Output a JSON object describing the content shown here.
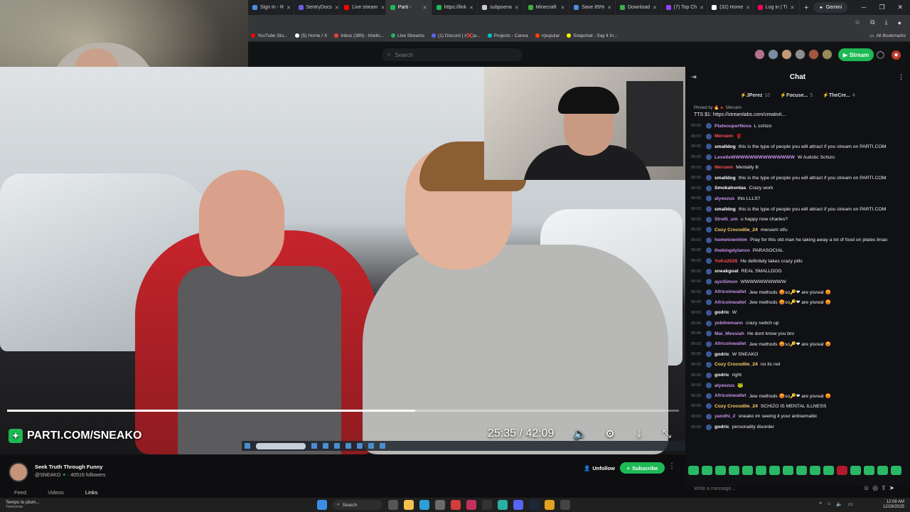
{
  "browser": {
    "tabs": [
      {
        "label": "Sign In - R",
        "color": "#4a90e2",
        "active": false
      },
      {
        "label": "SentryDocs",
        "color": "#6c5ce7",
        "active": false
      },
      {
        "label": "Live stream",
        "color": "#ff0000",
        "active": false
      },
      {
        "label": "Parti - ",
        "color": "#1db954",
        "active": true
      },
      {
        "label": "https://link",
        "color": "#1db954",
        "active": false
      },
      {
        "label": "subpoena",
        "color": "#cccccc",
        "active": false
      },
      {
        "label": "Minecraft",
        "color": "#3cb043",
        "active": false
      },
      {
        "label": "Save 85%",
        "color": "#4a90e2",
        "active": false
      },
      {
        "label": "Download",
        "color": "#3cb043",
        "active": false
      },
      {
        "label": "(7) Top Ch",
        "color": "#9146ff",
        "active": false
      },
      {
        "label": "(32) Home",
        "color": "#ffffff",
        "active": false
      },
      {
        "label": "Log in | Ti",
        "color": "#ff0050",
        "active": false
      }
    ],
    "new_tab": "+",
    "gemini_label": "Gemini",
    "bookmarks": [
      {
        "label": "YouTube Stu...",
        "color": "#ff0000"
      },
      {
        "label": "(5) Home / X",
        "color": "#ffffff"
      },
      {
        "label": "Inbox (389) - khells...",
        "color": "#ea4335"
      },
      {
        "label": "Live Streams",
        "color": "#1db954"
      },
      {
        "label": "(1) Discord | #❌|a...",
        "color": "#5865f2"
      },
      {
        "label": "Projects - Canva",
        "color": "#00c4cc"
      },
      {
        "label": "r/popular",
        "color": "#ff4500"
      },
      {
        "label": "Snapchat - Say it In...",
        "color": "#fffc00"
      }
    ],
    "all_bookmarks": "All Bookmarks"
  },
  "site": {
    "search_placeholder": "Search",
    "stream_button": "Stream"
  },
  "player": {
    "watermark": "PARTI.COM/SNEAKO",
    "current_time": "25:35",
    "separator": " / ",
    "duration": "42:09",
    "progress_fraction": 0.607
  },
  "chat": {
    "title": "Chat",
    "leaders": [
      {
        "name": "JPerez",
        "count": "10"
      },
      {
        "name": "Focuse...",
        "count": "5"
      },
      {
        "name": "TheCre...",
        "count": "4"
      }
    ],
    "pinned_by": "Pinned by 🔥🔺 Meruem",
    "pinned_text": "TTS $1: https://streamlabs.com/creativit...",
    "messages": [
      {
        "ts": "00:03",
        "user": "PlateouperNova",
        "color": "#c792ea",
        "text": "L schizo"
      },
      {
        "ts": "00:03",
        "user": "Meruem",
        "color": "#ff4d4d",
        "text": "🌹"
      },
      {
        "ts": "00:03",
        "user": "smalldog",
        "color": "#ffffff",
        "text": "this is the type of people you will attract if you stream on PARTI.COM"
      },
      {
        "ts": "00:03",
        "user": "LevelleWWWWWWWWWWWWWW",
        "color": "#c792ea",
        "text": "W Autistic Schizo"
      },
      {
        "ts": "00:03",
        "user": "Meruem",
        "color": "#ff4d4d",
        "text": "Mentally ill"
      },
      {
        "ts": "00:03",
        "user": "smalldog",
        "color": "#ffffff",
        "text": "this is the type of people you will attract if you stream on PARTI.COM"
      },
      {
        "ts": "00:03",
        "user": "Smokahontas",
        "color": "#ffffff",
        "text": "Crazy work"
      },
      {
        "ts": "00:03",
        "user": "alyeezus",
        "color": "#c792ea",
        "text": "this LLLS?"
      },
      {
        "ts": "00:03",
        "user": "smalldog",
        "color": "#ffffff",
        "text": "this is the type of people you will attract if you stream on PARTI.COM"
      },
      {
        "ts": "00:03",
        "user": "Strelli_um",
        "color": "#c792ea",
        "text": "u happy now charles?"
      },
      {
        "ts": "00:03",
        "user": "Cozy Crocodile_24",
        "color": "#ffd166",
        "text": "meruem stfu"
      },
      {
        "ts": "00:03",
        "user": "hometownhim",
        "color": "#c792ea",
        "text": "Pray for this old man he taking away a lot of food on plates lmao"
      },
      {
        "ts": "00:03",
        "user": "thekingdylanxo",
        "color": "#c792ea",
        "text": "PARASOCIAL"
      },
      {
        "ts": "00:03",
        "user": "YoKo2026",
        "color": "#ff4d4d",
        "text": "He definitely takes crazy pills"
      },
      {
        "ts": "00:03",
        "user": "sneakgoat",
        "color": "#ffffff",
        "text": "REAL SMALLDOG"
      },
      {
        "ts": "00:03",
        "user": "ayoSimon",
        "color": "#c792ea",
        "text": "WWWWWWWWWW"
      },
      {
        "ts": "00:03",
        "user": "Africoinwallet",
        "color": "#c792ea",
        "text": "Jew methods 😡so🔑❤ are yisreal 😡"
      },
      {
        "ts": "00:03",
        "user": "Africoinwallet",
        "color": "#c792ea",
        "text": "Jew methods 😡so🔑❤ are yisreal 😡"
      },
      {
        "ts": "00:03",
        "user": "godric",
        "color": "#ffffff",
        "text": "W"
      },
      {
        "ts": "00:04",
        "user": "yebthemann",
        "color": "#c792ea",
        "text": "crazy switch up"
      },
      {
        "ts": "00:04",
        "user": "Mai_Messiah",
        "color": "#c792ea",
        "text": "He dont know you bro"
      },
      {
        "ts": "00:03",
        "user": "Africoinwallet",
        "color": "#c792ea",
        "text": "Jew methods 😡so🔑❤ are yisreal 😡"
      },
      {
        "ts": "00:03",
        "user": "godric",
        "color": "#ffffff",
        "text": "W SNEAKO"
      },
      {
        "ts": "00:03",
        "user": "Cozy Crocodile_24",
        "color": "#ffd166",
        "text": "no its not"
      },
      {
        "ts": "00:03",
        "user": "godric",
        "color": "#ffffff",
        "text": "right"
      },
      {
        "ts": "00:03",
        "user": "alyeezus",
        "color": "#c792ea",
        "text": "🐸"
      },
      {
        "ts": "00:03",
        "user": "Africoinwallet",
        "color": "#c792ea",
        "text": "Jew methods 😡so🔑❤ are yisreal 😡"
      },
      {
        "ts": "00:03",
        "user": "Cozy Crocodile_24",
        "color": "#ffd166",
        "text": "SCHIZO IS MENTAL ILLNESS"
      },
      {
        "ts": "00:03",
        "user": "yandhi_2",
        "color": "#c792ea",
        "text": "sneako im seeing it your antisemaitic"
      },
      {
        "ts": "00:03",
        "user": "godric",
        "color": "#ffffff",
        "text": "personality disorder"
      }
    ],
    "input_placeholder": "Write a message..."
  },
  "channel": {
    "title": "Seek Truth Through Funny",
    "handle": "@SNEAKO",
    "followers": "40516",
    "followers_label": "followers",
    "tabs": [
      "Feed",
      "Videos",
      "Links"
    ],
    "active_tab": "Links",
    "unfollow_label": "Unfollow",
    "subscribe_label": "Subscribe"
  },
  "taskbar": {
    "weather_line1": "Temps to plum...",
    "weather_line2": "Tomorrow",
    "search_label": "Search",
    "time": "12:08 AM",
    "date": "12/28/2025"
  },
  "colors": {
    "accent": "#1db954",
    "background": "#0e0e10"
  }
}
